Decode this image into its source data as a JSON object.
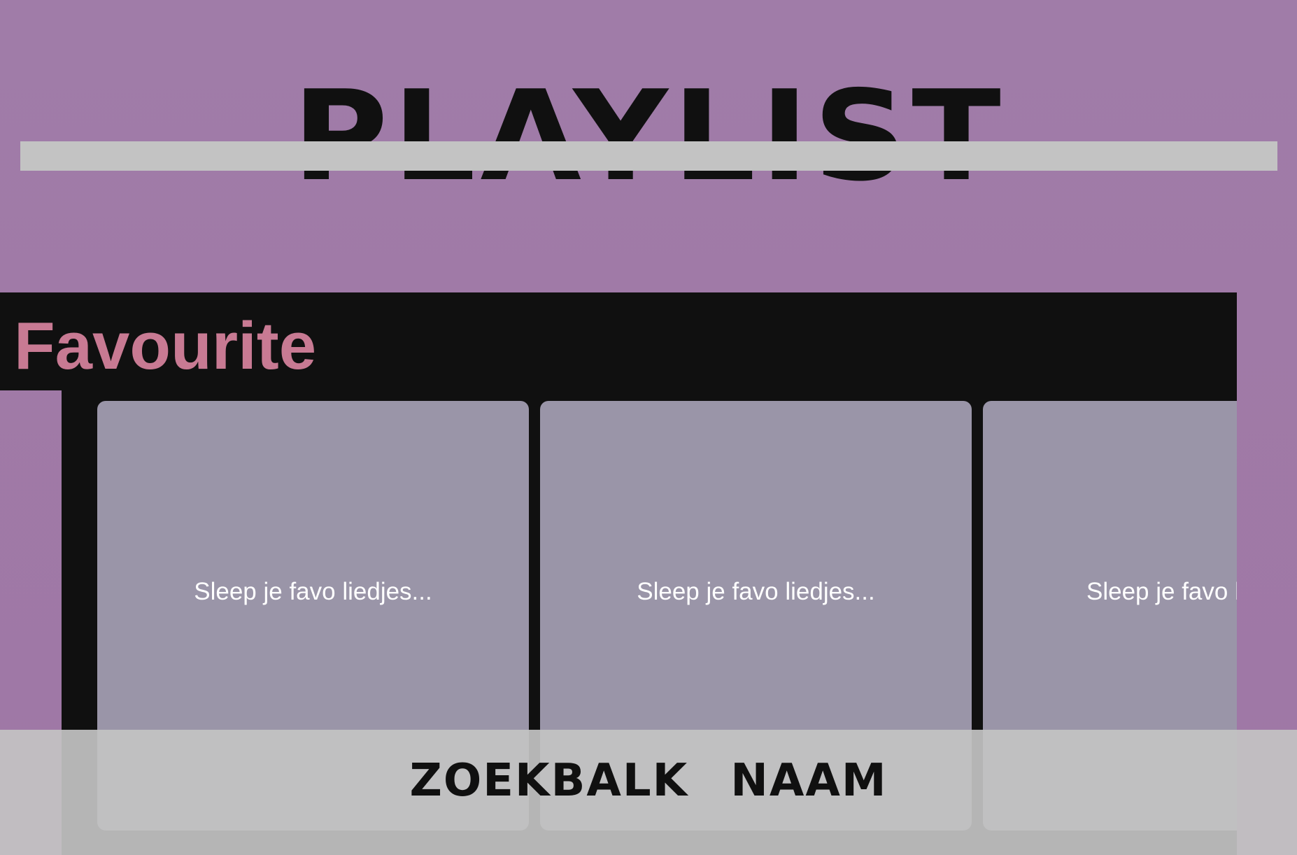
{
  "header": {
    "title": "PLAYLIST"
  },
  "favourites": {
    "title": "Favourite",
    "cards": [
      {
        "placeholder": "Sleep je favo liedjes..."
      },
      {
        "placeholder": "Sleep je favo liedjes..."
      },
      {
        "placeholder": "Sleep je favo liedjes..."
      }
    ]
  },
  "bottom_bar": {
    "search_label": "ZOEKBALK",
    "name_label": "NAAM"
  },
  "colors": {
    "background": "#a07ca8",
    "panel": "#101010",
    "accent_title": "#c87a93",
    "card": "#9a95a8",
    "bar": "#c3c3c3"
  }
}
